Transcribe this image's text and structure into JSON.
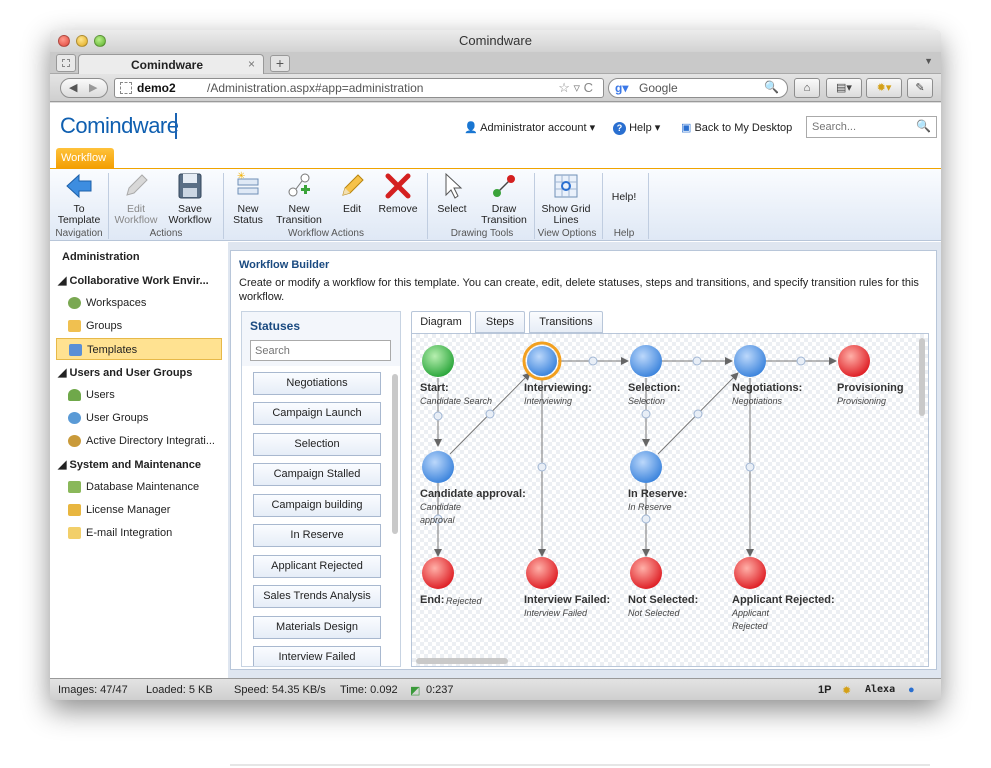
{
  "browser": {
    "window_title": "Comindware",
    "tab_title": "Comindware",
    "tab_close": "×",
    "new_tab": "+",
    "url_host": "demo2",
    "url_path": "/Administration.aspx#app=administration",
    "search_engine_text": "Google"
  },
  "header": {
    "logo": "Comindware",
    "account": "Administrator account",
    "help": "Help",
    "back": "Back to My Desktop",
    "search_placeholder": "Search..."
  },
  "ribbon": {
    "tab": "Workflow",
    "buttons": {
      "to_template": "To Template",
      "edit_workflow": "Edit Workflow",
      "save_workflow": "Save Workflow",
      "new_status": "New Status",
      "new_transition": "New Transition",
      "edit": "Edit",
      "remove": "Remove",
      "select": "Select",
      "draw_transition": "Draw Transition",
      "show_grid_lines": "Show Grid Lines",
      "help": "Help!"
    },
    "groups": {
      "navigation": "Navigation",
      "actions": "Actions",
      "workflow_actions": "Workflow Actions",
      "drawing_tools": "Drawing Tools",
      "view_options": "View Options",
      "help": "Help"
    }
  },
  "leftnav": {
    "title": "Administration",
    "sections": [
      {
        "label": "Collaborative Work Envir...",
        "items": [
          "Workspaces",
          "Groups",
          "Templates"
        ]
      },
      {
        "label": "Users and User Groups",
        "items": [
          "Users",
          "User Groups",
          "Active Directory Integrati..."
        ]
      },
      {
        "label": "System and Maintenance",
        "items": [
          "Database Maintenance",
          "License Manager",
          "E-mail Integration"
        ]
      }
    ],
    "selected": "Templates"
  },
  "builder": {
    "title": "Workflow Builder",
    "description": "Create or modify a workflow for this template. You can create, edit, delete statuses, steps and transitions, and specify transition rules for this workflow.",
    "statuses_title": "Statuses",
    "statuses_search": "Search",
    "statuses": [
      "Negotiations",
      "Campaign Launch",
      "Selection",
      "Campaign Stalled",
      "Campaign building",
      "In Reserve",
      "Applicant Rejected",
      "Sales Trends Analysis",
      "Materials Design",
      "Interview Failed"
    ],
    "tabs": [
      "Diagram",
      "Steps",
      "Transitions"
    ],
    "active_tab": "Diagram"
  },
  "diagram": {
    "nodes": [
      {
        "label": "Start:",
        "sub": "Candidate Search",
        "color": "green"
      },
      {
        "label": "Interviewing:",
        "sub": "Interviewing",
        "color": "blue",
        "selected": true
      },
      {
        "label": "Selection:",
        "sub": "Selection",
        "color": "blue"
      },
      {
        "label": "Negotiations:",
        "sub": "Negotiations",
        "color": "blue"
      },
      {
        "label": "Provisioning",
        "sub": "Provisioning",
        "color": "red"
      },
      {
        "label": "Candidate approval:",
        "sub": "Candidate approval",
        "color": "blue"
      },
      {
        "label": "In Reserve:",
        "sub": "In Reserve",
        "color": "blue"
      },
      {
        "label": "End:",
        "sub": "Rejected",
        "color": "red"
      },
      {
        "label": "Interview Failed:",
        "sub": "Interview Failed",
        "color": "red"
      },
      {
        "label": "Not Selected:",
        "sub": "Not Selected",
        "color": "red"
      },
      {
        "label": "Applicant Rejected:",
        "sub": "Applicant Rejected",
        "color": "red"
      }
    ]
  },
  "statusbar": {
    "images": "Images: 47/47",
    "loaded": "Loaded: 5 KB",
    "speed": "Speed: 54.35 KB/s",
    "time": "Time: 0.092",
    "elapsed": "0:237",
    "pagerank": "1P",
    "alexa": "Alexa"
  },
  "colors": {
    "brand_blue": "#0f5fb0",
    "ribbon_orange": "#f29d00",
    "selected_item": "#ffe291",
    "node_blue": "#4a8fe0",
    "node_red": "#e0282d",
    "node_green": "#37b14a"
  }
}
